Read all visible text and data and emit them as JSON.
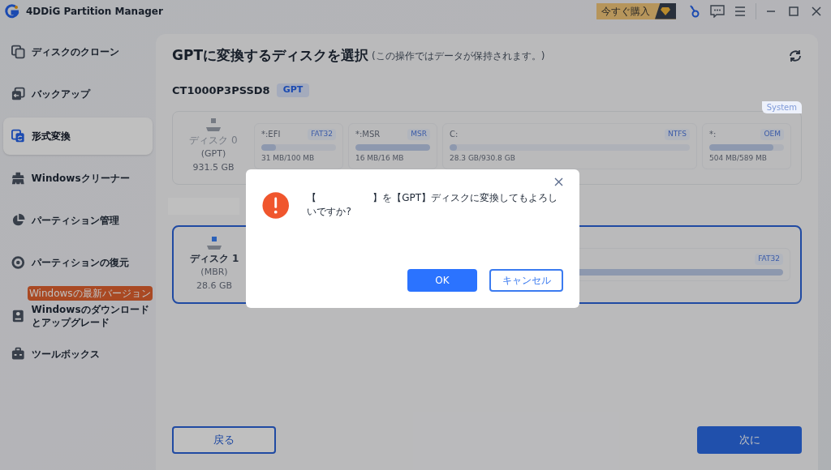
{
  "app_title": "4DDiG Partition Manager",
  "buy_button": "今すぐ購入",
  "sidebar": {
    "items": [
      {
        "label": "ディスクのクローン",
        "selected": false
      },
      {
        "label": "バックアップ",
        "selected": false
      },
      {
        "label": "形式変換",
        "selected": true
      },
      {
        "label": "Windowsクリーナー",
        "selected": false
      },
      {
        "label": "パーティション管理",
        "selected": false
      },
      {
        "label": "パーティションの復元",
        "selected": false
      },
      {
        "label": "Windowsのダウンロードとアップグレード",
        "selected": false,
        "badge": "Windowsの最新バージョン"
      },
      {
        "label": "ツールボックス",
        "selected": false
      }
    ]
  },
  "main": {
    "title": "GPTに変換するディスクを選択",
    "subtitle": "(この操作ではデータが保持されます。)",
    "disk_model": "CT1000P3PSSD8",
    "disk_model_tag": "GPT",
    "disks": [
      {
        "selected": false,
        "corner_tag": "System",
        "label": "ディスク 0",
        "scheme": "(GPT)",
        "size": "931.5 GB",
        "partitions": [
          {
            "name": "*:EFI",
            "fs": "FAT32",
            "level": 0.2,
            "usage": "31 MB/100 MB",
            "grow": false
          },
          {
            "name": "*:MSR",
            "fs": "MSR",
            "level": 1.0,
            "usage": "16 MB/16 MB",
            "grow": false
          },
          {
            "name": "C:",
            "fs": "NTFS",
            "level": 0.03,
            "usage": "28.3 GB/930.8 GB",
            "grow": true
          },
          {
            "name": "*:",
            "fs": "OEM",
            "level": 0.86,
            "usage": "504 MB/589 MB",
            "grow": false
          }
        ]
      },
      {
        "selected": true,
        "label": "ディスク 1",
        "scheme": "(MBR)",
        "size": "28.6 GB",
        "partitions": [
          {
            "fs": "FAT32",
            "level": 1.0,
            "grow": true
          }
        ]
      }
    ],
    "back_button": "戻る",
    "next_button": "次に"
  },
  "dialog": {
    "message": "【                  】を【GPT】ディスクに変換してもよろしいですか?",
    "ok_button": "OK",
    "cancel_button": "キャンセル"
  }
}
